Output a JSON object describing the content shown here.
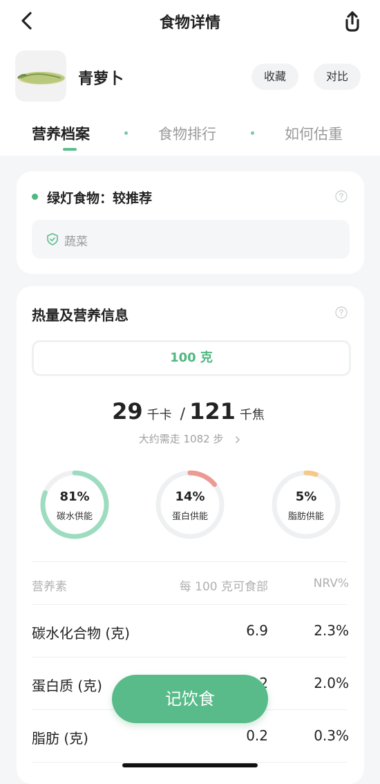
{
  "nav": {
    "title": "食物详情"
  },
  "food": {
    "name": "青萝卜",
    "favorite_label": "收藏",
    "compare_label": "对比"
  },
  "tabs": [
    {
      "label": "营养档案",
      "active": true
    },
    {
      "label": "食物排行",
      "active": false
    },
    {
      "label": "如何估重",
      "active": false
    }
  ],
  "recommendation": {
    "label": "绿灯食物：较推荐",
    "color": "#4fb882",
    "category_tag": "蔬菜"
  },
  "nutrition": {
    "title": "热量及营养信息",
    "weight": "100 克",
    "kcal": "29",
    "kcal_unit": "千卡",
    "separator": "/",
    "kj": "121",
    "kj_unit": "千焦",
    "steps_text": "大约需走 1082 步",
    "rings": [
      {
        "percent": "81%",
        "label": "碳水供能",
        "value": 81,
        "color": "#9ddcc0"
      },
      {
        "percent": "14%",
        "label": "蛋白供能",
        "value": 14,
        "color": "#ec9a92"
      },
      {
        "percent": "5%",
        "label": "脂肪供能",
        "value": 5,
        "color": "#f5c989"
      }
    ],
    "table": {
      "headers": [
        "营养素",
        "每 100 克可食部",
        "NRV%"
      ],
      "rows": [
        {
          "name": "碳水化合物 (克)",
          "value": "6.9",
          "nrv": "2.3%"
        },
        {
          "name": "蛋白质 (克)",
          "value": "1.2",
          "nrv": "2.0%"
        },
        {
          "name": "脂肪 (克)",
          "value": "0.2",
          "nrv": "0.3%"
        }
      ]
    }
  },
  "action": {
    "log_label": "记饮食"
  },
  "theme": {
    "accent": "#58bb89",
    "track": "#eef0f2"
  }
}
